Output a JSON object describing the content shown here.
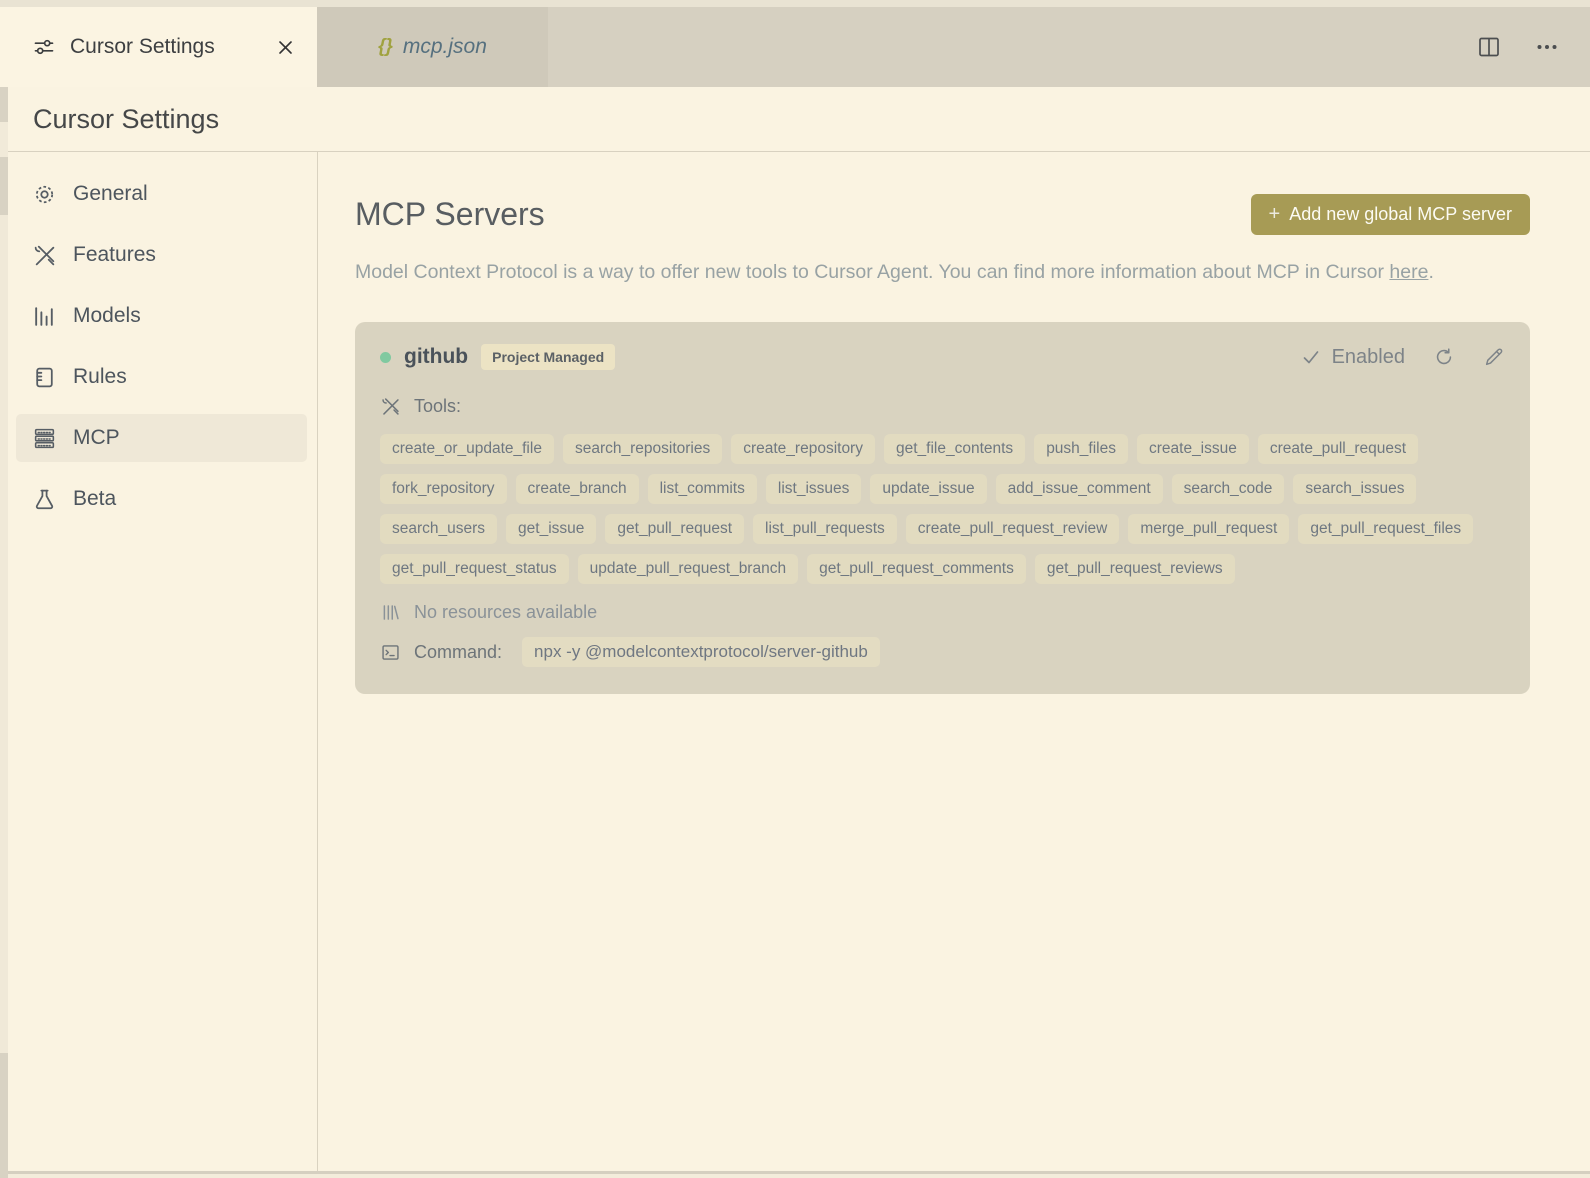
{
  "tab_bar": {
    "active_tab": {
      "label": "Cursor Settings",
      "icon": "sliders-icon"
    },
    "inactive_tab": {
      "label": "mcp.json",
      "icon": "braces-icon",
      "braces": "{}"
    },
    "actions": {
      "split_editor": "split-editor-icon",
      "more": "more-actions-icon"
    }
  },
  "title_row": {
    "title": "Cursor Settings"
  },
  "sidebar": {
    "items": [
      {
        "label": "General",
        "icon": "gear-icon",
        "active": false
      },
      {
        "label": "Features",
        "icon": "tools-icon",
        "active": false
      },
      {
        "label": "Models",
        "icon": "bar-chart-icon",
        "active": false
      },
      {
        "label": "Rules",
        "icon": "notepad-icon",
        "active": false
      },
      {
        "label": "MCP",
        "icon": "server-icon",
        "active": true
      },
      {
        "label": "Beta",
        "icon": "flask-icon",
        "active": false
      }
    ]
  },
  "main": {
    "title": "MCP Servers",
    "add_button": {
      "plus": "+",
      "label": "Add new global MCP server"
    },
    "description": {
      "text_before_link": "Model Context Protocol is a way to offer new tools to Cursor Agent. You can find more information about MCP in Cursor ",
      "link": "here",
      "text_after_link": "."
    },
    "server": {
      "name": "github",
      "badge": "Project Managed",
      "status": "Enabled",
      "status_icon": "check-icon",
      "tools_label": "Tools:",
      "tools": [
        "create_or_update_file",
        "search_repositories",
        "create_repository",
        "get_file_contents",
        "push_files",
        "create_issue",
        "create_pull_request",
        "fork_repository",
        "create_branch",
        "list_commits",
        "list_issues",
        "update_issue",
        "add_issue_comment",
        "search_code",
        "search_issues",
        "search_users",
        "get_issue",
        "get_pull_request",
        "list_pull_requests",
        "create_pull_request_review",
        "merge_pull_request",
        "get_pull_request_files",
        "get_pull_request_status",
        "update_pull_request_branch",
        "get_pull_request_comments",
        "get_pull_request_reviews"
      ],
      "resources_text": "No resources available",
      "command_label": "Command:",
      "command": "npx -y @modelcontextprotocol/server-github"
    }
  },
  "colors": {
    "background_cream": "#faf3e1",
    "tab_bar_tan": "#d6d0c1",
    "inactive_tab": "#cfc9ba",
    "card_background": "#d9d3c0",
    "tag_background": "#e2dbc0",
    "badge_background": "#ece3c4",
    "accent_olive": "#a79b55",
    "status_green": "#80c9a0",
    "braces_olive": "#a0a23f"
  }
}
